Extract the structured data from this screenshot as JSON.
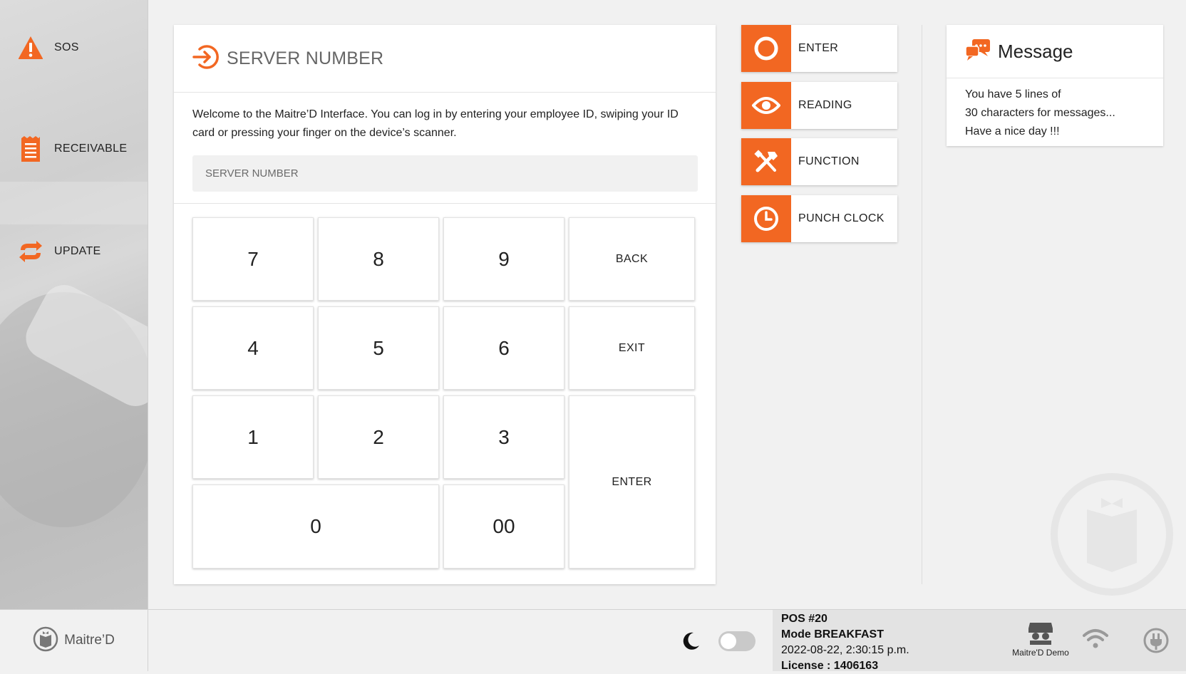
{
  "sidebar": {
    "items": [
      {
        "label": "SOS",
        "icon": "warning-icon"
      },
      {
        "label": "RECEIVABLE",
        "icon": "receipt-icon"
      },
      {
        "label": "UPDATE",
        "icon": "sync-icon"
      }
    ]
  },
  "login": {
    "title": "SERVER NUMBER",
    "welcome": "Welcome to the Maitre’D Interface. You can log in by entering your employee ID, swiping your ID card or pressing your finger on the device’s scanner.",
    "input_placeholder": "SERVER NUMBER",
    "input_value": ""
  },
  "keypad": {
    "k7": "7",
    "k8": "8",
    "k9": "9",
    "back": "BACK",
    "k4": "4",
    "k5": "5",
    "k6": "6",
    "exit": "EXIT",
    "k1": "1",
    "k2": "2",
    "k3": "3",
    "enter": "ENTER",
    "k0": "0",
    "k00": "00"
  },
  "actions": [
    {
      "label": "ENTER",
      "icon": "circle-icon"
    },
    {
      "label": "READING",
      "icon": "eye-icon"
    },
    {
      "label": "FUNCTION",
      "icon": "tools-icon"
    },
    {
      "label": "PUNCH CLOCK",
      "icon": "clock-icon"
    }
  ],
  "message": {
    "title": "Message",
    "lines": [
      "You have 5 lines of",
      "30 characters for messages...",
      "Have a nice day !!!"
    ]
  },
  "bottom": {
    "brand": "Maitre’D",
    "pos": "POS #20",
    "mode": "Mode BREAKFAST",
    "datetime": "2022-08-22, 2:30:15 p.m.",
    "license": "License : 1406163",
    "demo_label": "Maitre'D Demo"
  },
  "colors": {
    "accent": "#f26722"
  }
}
